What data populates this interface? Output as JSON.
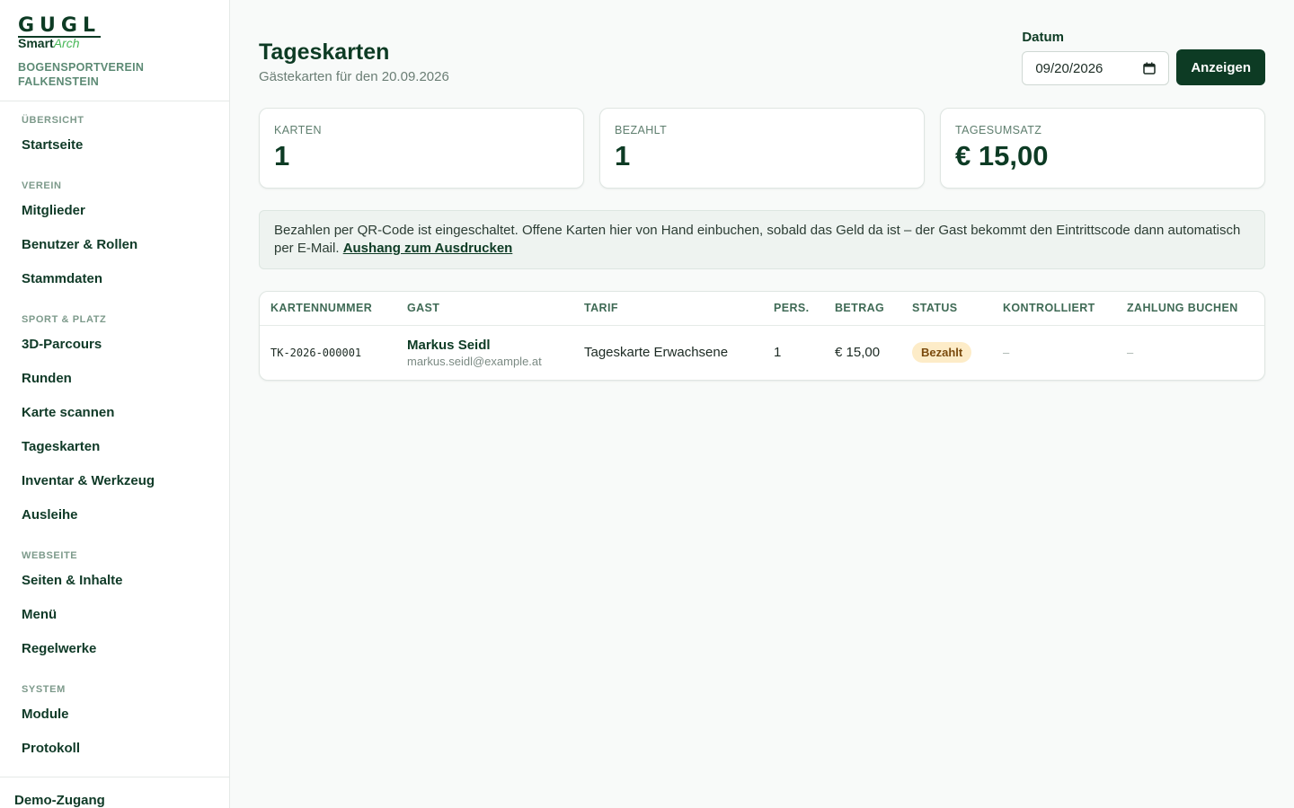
{
  "brand": {
    "logo_top": "GUGL",
    "logo_smart": "Smart",
    "logo_arch": "Arch",
    "club": "BOGENSPORTVEREIN FALKENSTEIN"
  },
  "nav": {
    "sections": [
      {
        "title": "ÜBERSICHT",
        "items": [
          "Startseite"
        ]
      },
      {
        "title": "VEREIN",
        "items": [
          "Mitglieder",
          "Benutzer & Rollen",
          "Stammdaten"
        ]
      },
      {
        "title": "SPORT & PLATZ",
        "items": [
          "3D-Parcours",
          "Runden",
          "Karte scannen",
          "Tageskarten",
          "Inventar & Werkzeug",
          "Ausleihe"
        ]
      },
      {
        "title": "WEBSEITE",
        "items": [
          "Seiten & Inhalte",
          "Menü",
          "Regelwerke"
        ]
      },
      {
        "title": "SYSTEM",
        "items": [
          "Module",
          "Protokoll"
        ]
      }
    ],
    "footer": "Demo-Zugang"
  },
  "page": {
    "title": "Tageskarten",
    "subtitle": "Gästekarten für den 20.09.2026",
    "date_label": "Datum",
    "date_value": "09/20/2026",
    "show_button": "Anzeigen"
  },
  "stats": [
    {
      "label": "KARTEN",
      "value": "1"
    },
    {
      "label": "BEZAHLT",
      "value": "1"
    },
    {
      "label": "TAGESUMSATZ",
      "value": "€ 15,00"
    }
  ],
  "notice": {
    "text": "Bezahlen per QR-Code ist eingeschaltet. Offene Karten hier von Hand einbuchen, sobald das Geld da ist – der Gast bekommt den Eintrittscode dann automatisch per E-Mail. ",
    "link": "Aushang zum Ausdrucken"
  },
  "table": {
    "headers": [
      "KARTENNUMMER",
      "GAST",
      "TARIF",
      "PERS.",
      "BETRAG",
      "STATUS",
      "KONTROLLIERT",
      "ZAHLUNG BUCHEN"
    ],
    "rows": [
      {
        "number": "TK-2026-000001",
        "guest_name": "Markus Seidl",
        "guest_email": "markus.seidl@example.at",
        "tarif": "Tageskarte Erwachsene",
        "persons": "1",
        "amount": "€ 15,00",
        "status": "Bezahlt",
        "checked": "–",
        "booking": "–"
      }
    ]
  },
  "colors": {
    "primary": "#0d3b24",
    "accent_green": "#49b859",
    "badge_bg": "#fdecc8",
    "badge_text": "#7a4a0d"
  }
}
